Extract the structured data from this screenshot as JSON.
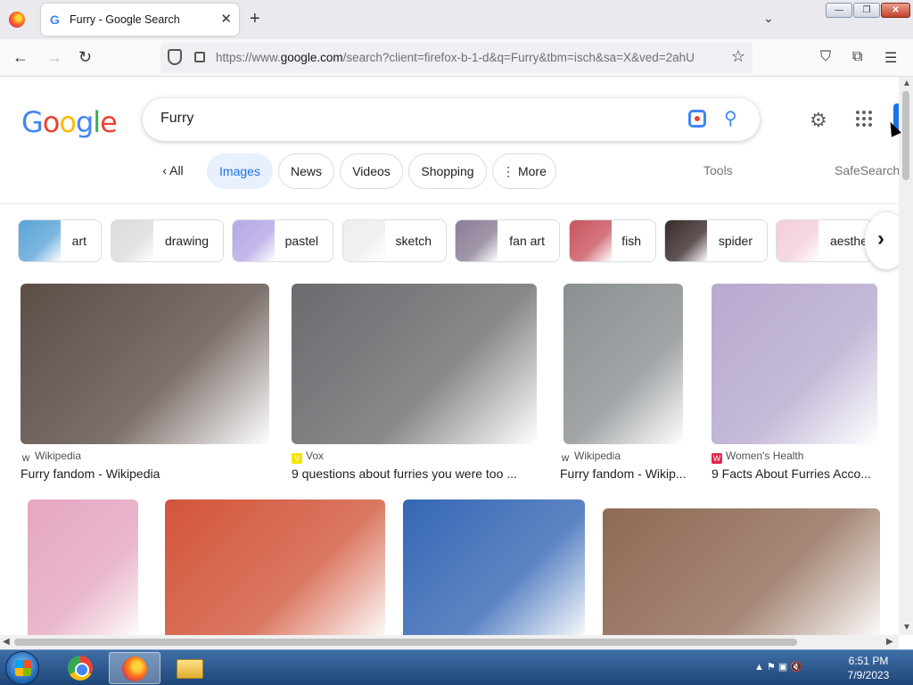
{
  "browser": {
    "tab_title": "Furry - Google Search",
    "tab_favicon": "G",
    "url_host_prefix": "https://www.",
    "url_host": "google.com",
    "url_path": "/search?client=firefox-b-1-d&q=Furry&tbm=isch&sa=X&ved=2ahU"
  },
  "google": {
    "query": "Furry",
    "logo": {
      "g1": "G",
      "o1": "o",
      "o2": "o",
      "g2": "g",
      "l": "l",
      "e": "e"
    },
    "filters": {
      "all": "All",
      "images": "Images",
      "news": "News",
      "videos": "Videos",
      "shopping": "Shopping",
      "more": "More",
      "tools": "Tools",
      "safesearch": "SafeSearch"
    },
    "related": [
      {
        "label": "art",
        "color": "#5aa4d8"
      },
      {
        "label": "drawing",
        "color": "#dcdcdc"
      },
      {
        "label": "pastel",
        "color": "#b6a7e6"
      },
      {
        "label": "sketch",
        "color": "#eeeeee"
      },
      {
        "label": "fan art",
        "color": "#8a7d95"
      },
      {
        "label": "fish",
        "color": "#c9545f"
      },
      {
        "label": "spider",
        "color": "#3a2a2a"
      },
      {
        "label": "aesthe",
        "color": "#f3cfd8"
      }
    ],
    "results": [
      {
        "source": "Wikipedia",
        "title": "Furry fandom - Wikipedia",
        "icon": "W",
        "icon_color": "#ffffff",
        "img_color": "#5c4d47"
      },
      {
        "source": "Vox",
        "title": "9 questions about furries you were too ...",
        "icon": "V",
        "icon_color": "#f5e400",
        "img_color": "#6b6a6e"
      },
      {
        "source": "Wikipedia",
        "title": "Furry fandom - Wikip...",
        "icon": "W",
        "icon_color": "#ffffff",
        "img_color": "#8a8f92"
      },
      {
        "source": "Women's Health",
        "title": "9 Facts About Furries Acco...",
        "icon": "W",
        "icon_color": "#e2264d",
        "img_color": "#b7a9cf"
      },
      {
        "img_color": "#e5a6c1"
      },
      {
        "img_color": "#d2553a"
      },
      {
        "img_color": "#3567b5"
      },
      {
        "img_color": "#8f6a55"
      }
    ]
  },
  "taskbar": {
    "time": "6:51 PM",
    "date": "7/9/2023"
  }
}
